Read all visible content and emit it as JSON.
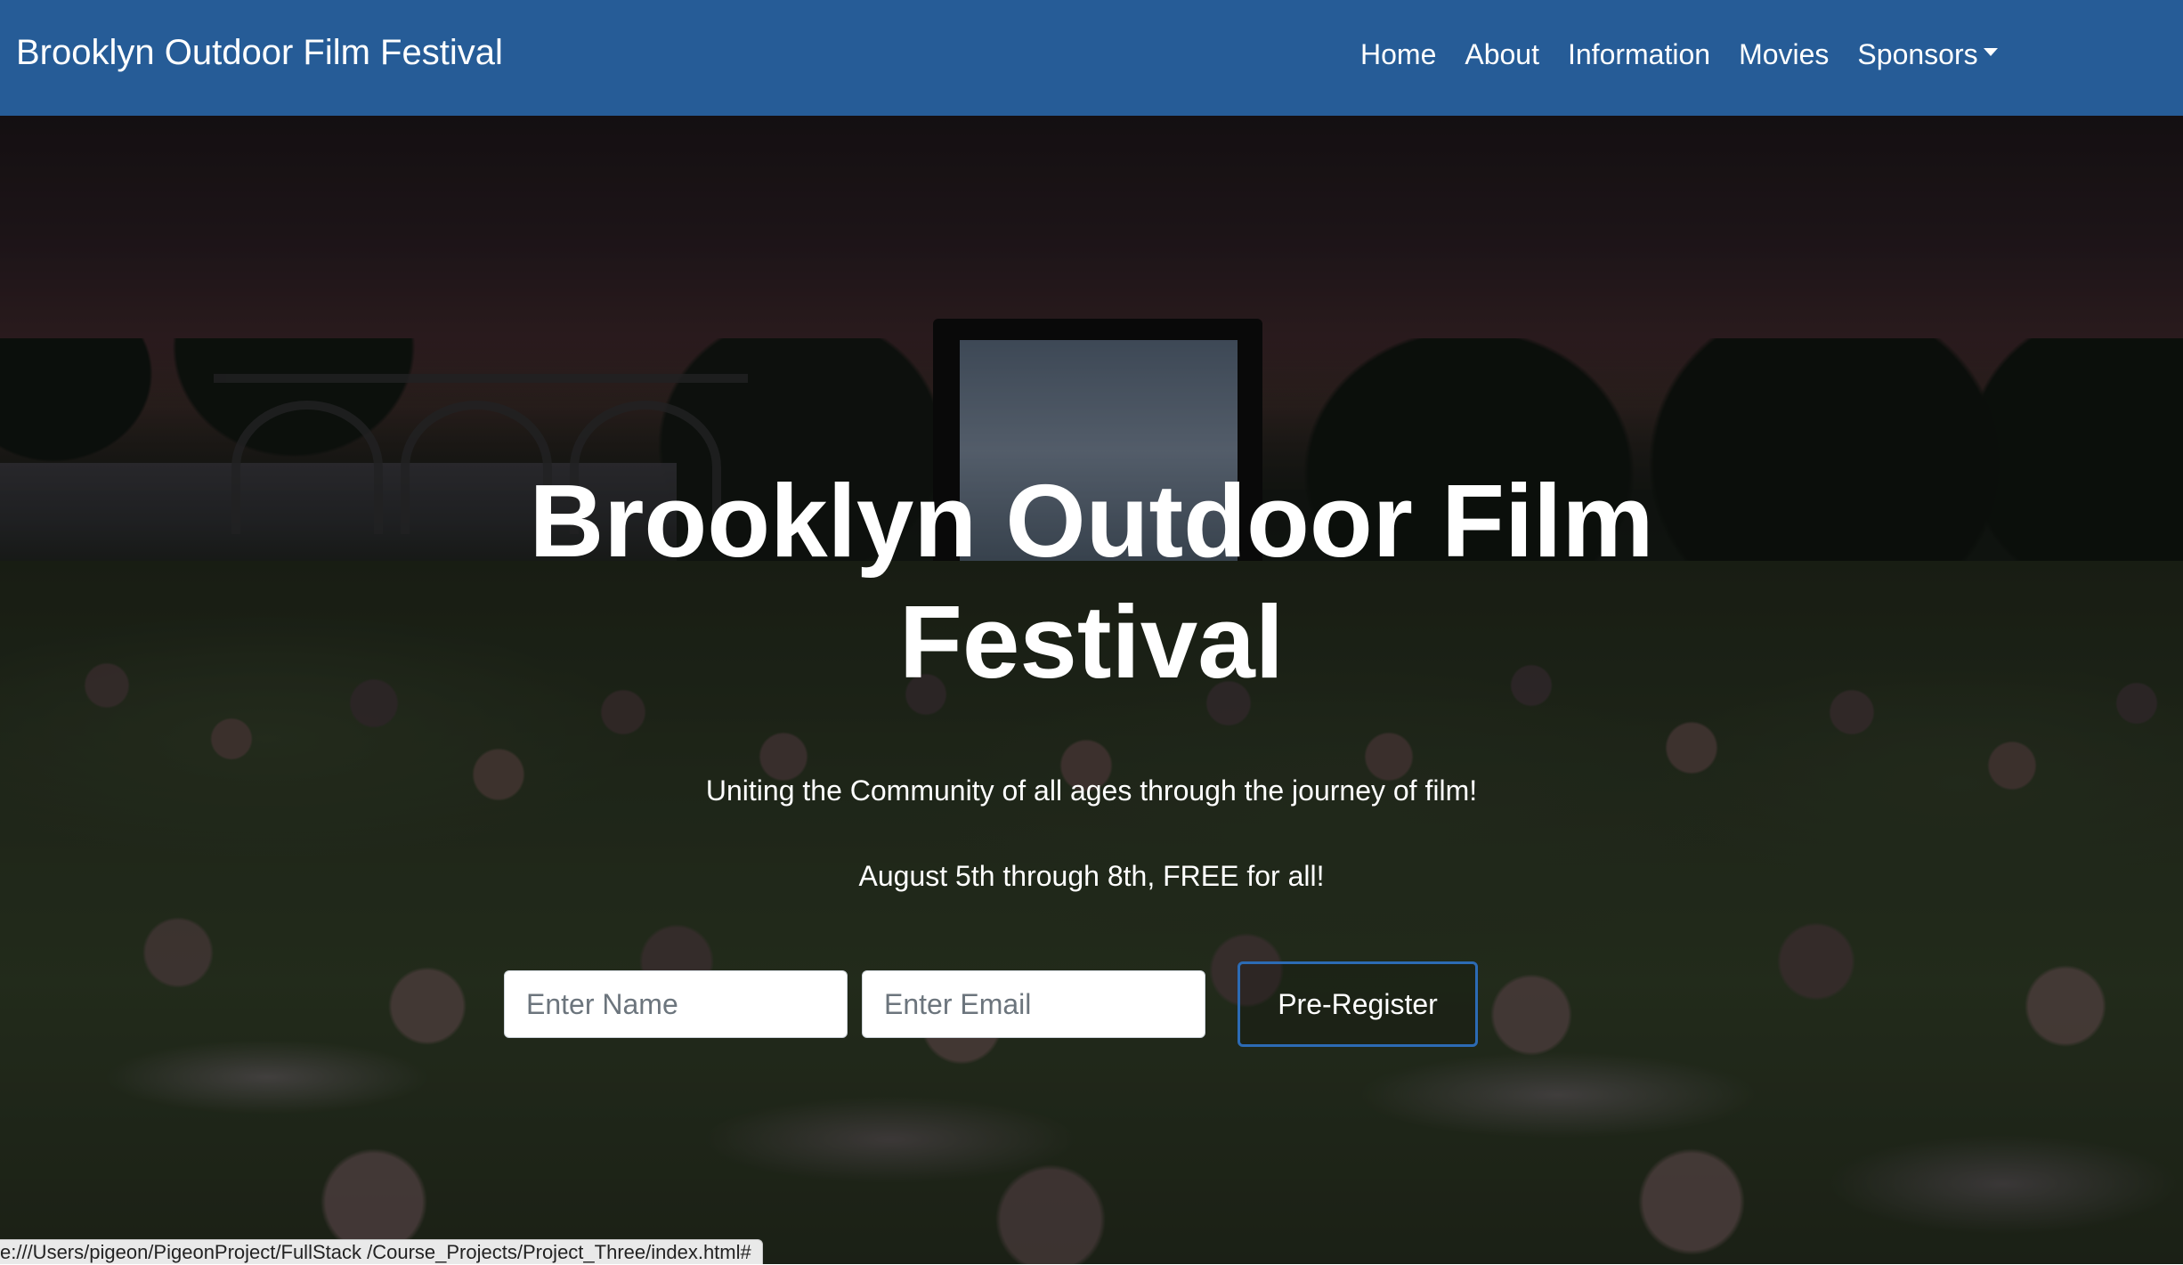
{
  "navbar": {
    "brand": "Brooklyn Outdoor Film Festival",
    "background_color": "#265c97",
    "links": [
      {
        "label": "Home"
      },
      {
        "label": "About"
      },
      {
        "label": "Information"
      },
      {
        "label": "Movies"
      },
      {
        "label": "Sponsors",
        "has_dropdown": true
      }
    ]
  },
  "hero": {
    "title": "Brooklyn Outdoor Film Festival",
    "tagline": "Uniting the Community of all ages through the journey of film!",
    "dates": "August 5th through 8th, FREE for all!",
    "form": {
      "name_placeholder": "Enter Name",
      "name_value": "",
      "email_placeholder": "Enter Email",
      "email_value": "",
      "submit_label": "Pre-Register",
      "submit_border_color": "#2c6bb5"
    }
  },
  "status_bar": {
    "url": "e:///Users/pigeon/PigeonProject/FullStack /Course_Projects/Project_Three/index.html#"
  }
}
